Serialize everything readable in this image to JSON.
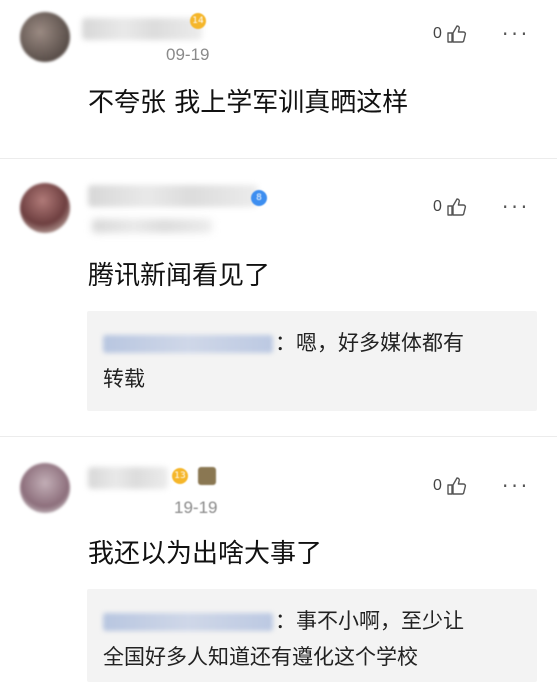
{
  "comments": [
    {
      "date": "09-19",
      "likes": "0",
      "more": "···",
      "text": "不夸张 我上学军训真晒这样",
      "badge": "14",
      "badge_color": "#f5b62a"
    },
    {
      "date": "",
      "likes": "0",
      "more": "···",
      "text": "腾讯新闻看见了",
      "badge": "8",
      "badge_color": "#3d8ef0",
      "reply": {
        "line1": "：嗯，好多媒体都有",
        "line2": "转载"
      }
    },
    {
      "date": "19-19",
      "likes": "0",
      "more": "···",
      "text": "我还以为出啥大事了",
      "badge": "13",
      "badge_color": "#f5b62a",
      "reply": {
        "line1": "：事不小啊，至少让",
        "line2": "全国好多人知道还有遵化这个学校"
      }
    }
  ]
}
